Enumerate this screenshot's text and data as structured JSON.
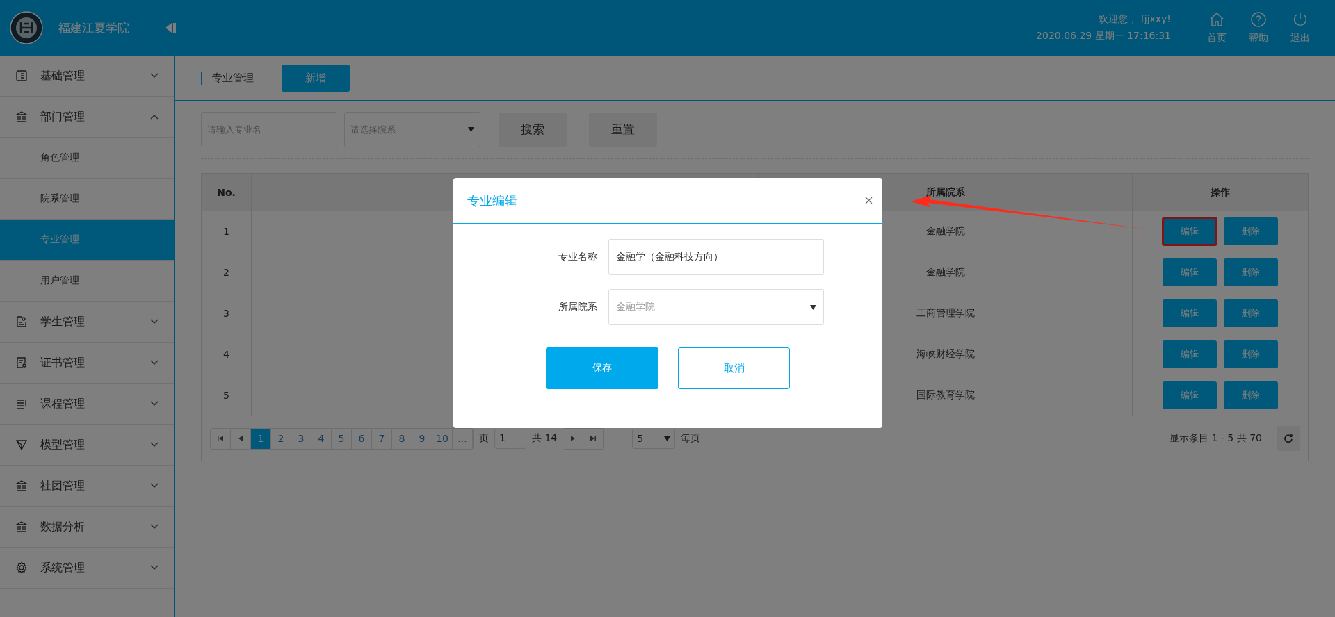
{
  "header": {
    "school_name": "福建江夏学院",
    "greeting": "欢迎您， fjjxxy!",
    "datetime": "2020.06.29 星期一 17:16:31",
    "actions": [
      {
        "label": "首页"
      },
      {
        "label": "帮助"
      },
      {
        "label": "退出"
      }
    ]
  },
  "sidebar": {
    "items": [
      {
        "label": "基础管理",
        "expanded": false
      },
      {
        "label": "部门管理",
        "expanded": true,
        "children": [
          {
            "label": "角色管理",
            "selected": false
          },
          {
            "label": "院系管理",
            "selected": false
          },
          {
            "label": "专业管理",
            "selected": true
          },
          {
            "label": "用户管理",
            "selected": false
          }
        ]
      },
      {
        "label": "学生管理",
        "expanded": false
      },
      {
        "label": "证书管理",
        "expanded": false
      },
      {
        "label": "课程管理",
        "expanded": false
      },
      {
        "label": "模型管理",
        "expanded": false
      },
      {
        "label": "社团管理",
        "expanded": false
      },
      {
        "label": "数据分析",
        "expanded": false
      },
      {
        "label": "系统管理",
        "expanded": false
      }
    ]
  },
  "page": {
    "title": "专业管理",
    "add_button": "新增"
  },
  "filters": {
    "name_placeholder": "请输入专业名",
    "department_placeholder": "请选择院系",
    "search_button": "搜索",
    "reset_button": "重置"
  },
  "table": {
    "columns": [
      "No.",
      "",
      "所属院系",
      "操作"
    ],
    "rows": [
      {
        "no": "1",
        "department": "金融学院",
        "edit": "编辑",
        "delete": "删除",
        "highlighted": true
      },
      {
        "no": "2",
        "department": "金融学院",
        "edit": "编辑",
        "delete": "删除",
        "highlighted": false
      },
      {
        "no": "3",
        "department": "工商管理学院",
        "edit": "编辑",
        "delete": "删除",
        "highlighted": false
      },
      {
        "no": "4",
        "department": "海峡财经学院",
        "edit": "编辑",
        "delete": "删除",
        "highlighted": false
      },
      {
        "no": "5",
        "department": "国际教育学院",
        "edit": "编辑",
        "delete": "删除",
        "highlighted": false
      }
    ]
  },
  "pagination": {
    "pages": [
      {
        "label": "1",
        "selected": true
      },
      {
        "label": "2",
        "selected": false
      },
      {
        "label": "3",
        "selected": false
      },
      {
        "label": "4",
        "selected": false
      },
      {
        "label": "5",
        "selected": false
      },
      {
        "label": "6",
        "selected": false
      },
      {
        "label": "7",
        "selected": false
      },
      {
        "label": "8",
        "selected": false
      },
      {
        "label": "9",
        "selected": false
      },
      {
        "label": "10",
        "selected": false
      }
    ],
    "ellipsis": "...",
    "page_prefix": "页",
    "page_input": "1",
    "page_total": "共 14",
    "page_size": "5",
    "page_size_suffix": "每页",
    "summary": "显示条目 1 - 5 共 70"
  },
  "dialog": {
    "title": "专业编辑",
    "fields": [
      {
        "kind": "text",
        "label": "专业名称",
        "value": "金融学（金融科技方向）"
      },
      {
        "kind": "select",
        "label": "所属院系",
        "value": "金融学院"
      }
    ],
    "save_button": "保存",
    "cancel_button": "取消"
  }
}
